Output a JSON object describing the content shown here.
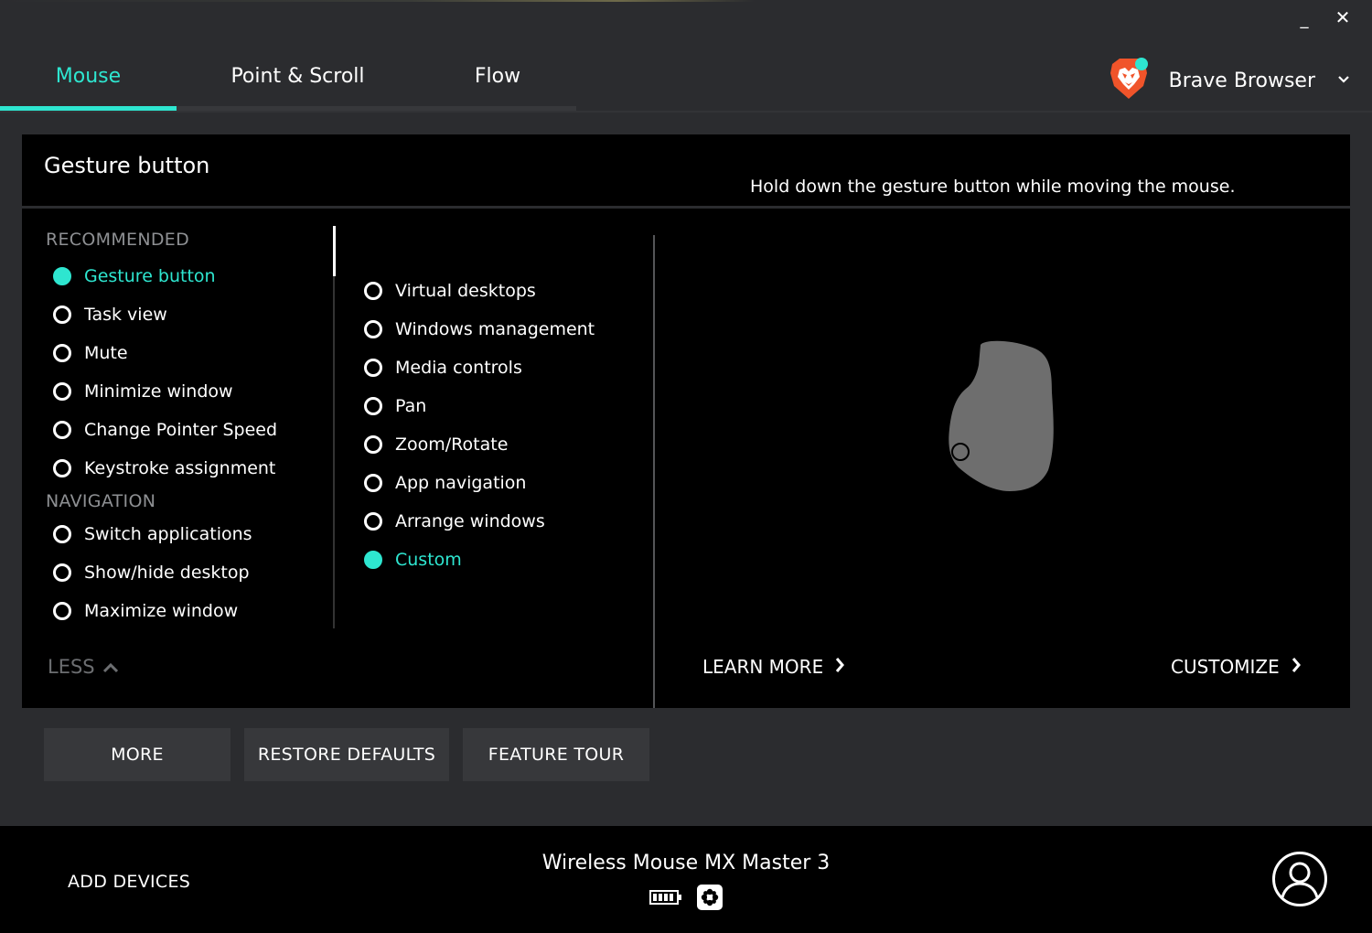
{
  "window": {
    "minimize_label": "_",
    "close_label": "✕"
  },
  "tabs": [
    {
      "label": "Mouse",
      "active": true
    },
    {
      "label": "Point & Scroll",
      "active": false
    },
    {
      "label": "Flow",
      "active": false
    }
  ],
  "app_selector": {
    "name": "Brave Browser",
    "icon": "brave-lion-icon",
    "chevron": "⌄"
  },
  "panel": {
    "title": "Gesture button",
    "description": "Hold down the gesture button while moving the mouse.",
    "sections": {
      "recommended": "RECOMMENDED",
      "navigation": "NAVIGATION"
    },
    "recommended_options": [
      {
        "label": "Gesture button",
        "selected": true
      },
      {
        "label": "Task view",
        "selected": false
      },
      {
        "label": "Mute",
        "selected": false
      },
      {
        "label": "Minimize window",
        "selected": false
      },
      {
        "label": "Change Pointer Speed",
        "selected": false
      },
      {
        "label": "Keystroke assignment",
        "selected": false
      }
    ],
    "navigation_options": [
      {
        "label": "Switch applications",
        "selected": false
      },
      {
        "label": "Show/hide desktop",
        "selected": false
      },
      {
        "label": "Maximize window",
        "selected": false
      }
    ],
    "less_label": "LESS",
    "gesture_options": [
      {
        "label": "Virtual desktops",
        "selected": false
      },
      {
        "label": "Windows management",
        "selected": false
      },
      {
        "label": "Media controls",
        "selected": false
      },
      {
        "label": "Pan",
        "selected": false
      },
      {
        "label": "Zoom/Rotate",
        "selected": false
      },
      {
        "label": "App navigation",
        "selected": false
      },
      {
        "label": "Arrange windows",
        "selected": false
      },
      {
        "label": "Custom",
        "selected": true
      }
    ],
    "learn_more": "LEARN MORE",
    "customize": "CUSTOMIZE"
  },
  "buttons": {
    "more": "MORE",
    "restore": "RESTORE DEFAULTS",
    "tour": "FEATURE TOUR"
  },
  "footer": {
    "add_devices": "ADD DEVICES",
    "device_name": "Wireless Mouse MX Master 3",
    "icons": [
      "battery-icon",
      "unifying-receiver-icon",
      "account-icon"
    ]
  },
  "colors": {
    "accent": "#2ee6d0",
    "background": "#2b2c2f",
    "panel": "#000000",
    "button": "#37383b"
  }
}
